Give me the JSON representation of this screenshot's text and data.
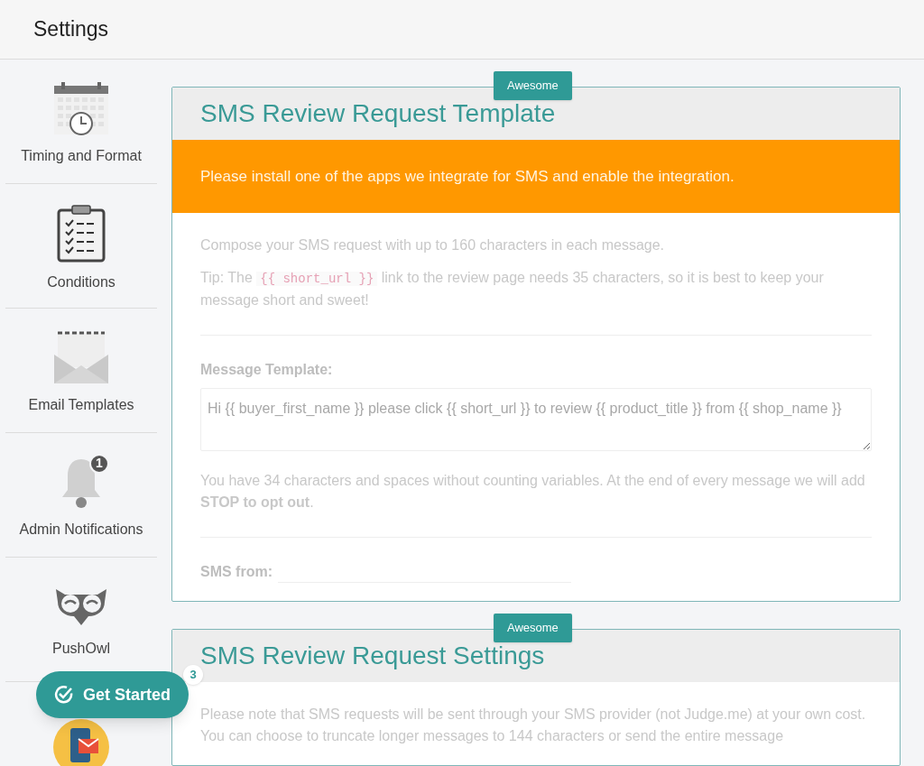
{
  "header": {
    "title": "Settings"
  },
  "sidebar": {
    "items": [
      {
        "kind": "calendar",
        "label": "Timing and Format"
      },
      {
        "kind": "clipboard",
        "label": "Conditions"
      },
      {
        "kind": "envelope",
        "label": "Email Templates"
      },
      {
        "kind": "bell",
        "label": "Admin Notifications",
        "badge": "1"
      },
      {
        "kind": "owl",
        "label": "PushOwl"
      },
      {
        "kind": "phone"
      }
    ]
  },
  "get_started": {
    "label": "Get Started",
    "badge": "3"
  },
  "cards": [
    {
      "tag": "Awesome",
      "title": "SMS Review Request Template",
      "alert": "Please install one of the apps we integrate for SMS and enable the integration.",
      "intro": "Compose your SMS request with up to 160 characters in each message.",
      "tip": {
        "before": "Tip: The",
        "code": "{{ short_url }}",
        "after": "link to the review page needs 35 characters, so it is best to keep your message short and sweet!"
      },
      "template_label": "Message Template:",
      "template_value": "Hi {{ buyer_first_name }} please click {{ short_url }} to review {{ product_title }} from {{ shop_name }}",
      "note": "You have 34 characters and spaces without counting variables. At the end of every message we will add **STOP to opt out**.",
      "from_label": "SMS from:"
    },
    {
      "tag": "Awesome",
      "title": "SMS Review Request Settings",
      "intro": "Please note that SMS requests will be sent through your SMS provider (not Judge.me) at your own cost. You can choose to truncate longer messages to 144 characters or send the entire message"
    }
  ]
}
